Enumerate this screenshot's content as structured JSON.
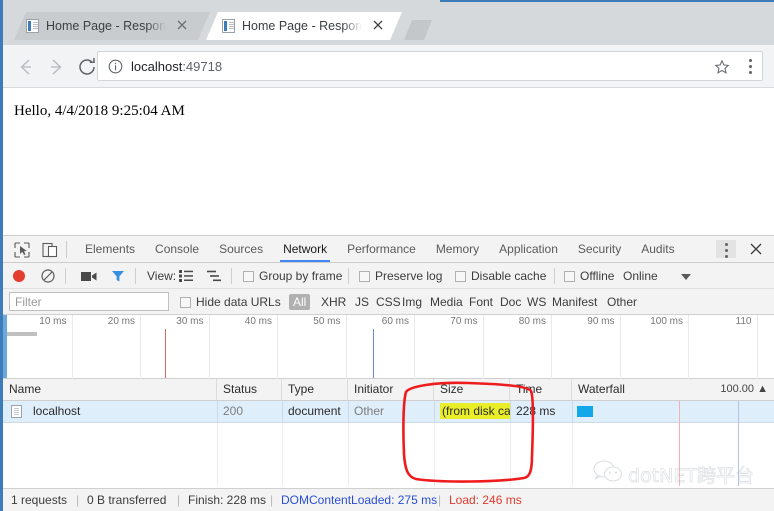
{
  "browser": {
    "tabs": [
      {
        "title": "Home Page - ResponseC",
        "active": false,
        "favicon": "page-icon"
      },
      {
        "title": "Home Page - ResponseC",
        "active": true,
        "favicon": "page-icon"
      }
    ],
    "new_tab_label": "+",
    "window_controls": {
      "minimize": "—",
      "maximize": "□",
      "close": "✕",
      "profile": "profile-avatar"
    },
    "omnibox": {
      "scheme_label": "",
      "url_host": "localhost",
      "url_port": ":49718",
      "full_url": "localhost:49718",
      "info_icon": "info-circle-icon",
      "star_icon": "star-icon",
      "menu_icon": "three-dot-menu-icon"
    },
    "nav": {
      "back": "←",
      "forward": "→",
      "reload": "⟳"
    }
  },
  "page": {
    "body_text": "Hello, 4/4/2018 9:25:04 AM"
  },
  "devtools": {
    "toolbar_icons": {
      "inspect": "inspect-element-icon",
      "device": "device-toolbar-icon",
      "kebab": "more-options-icon",
      "close": "close-devtools-icon"
    },
    "tabs": [
      {
        "label": "Elements",
        "active": false
      },
      {
        "label": "Console",
        "active": false
      },
      {
        "label": "Sources",
        "active": false
      },
      {
        "label": "Network",
        "active": true
      },
      {
        "label": "Performance",
        "active": false
      },
      {
        "label": "Memory",
        "active": false
      },
      {
        "label": "Application",
        "active": false
      },
      {
        "label": "Security",
        "active": false
      },
      {
        "label": "Audits",
        "active": false
      }
    ],
    "network_toolbar": {
      "record_icon": "record-button-icon",
      "clear_icon": "clear-icon",
      "camera_icon": "capture-screenshots-icon",
      "filter_icon": "filter-icon",
      "view_label": "View:",
      "view_list_icon": "list-view-icon",
      "view_waterfall_icon": "waterfall-view-icon",
      "group_by_frame": {
        "label": "Group by frame",
        "checked": false
      },
      "preserve_log": {
        "label": "Preserve log",
        "checked": false
      },
      "disable_cache": {
        "label": "Disable cache",
        "checked": false
      },
      "offline": {
        "label": "Offline",
        "checked": false
      },
      "online_label": "Online",
      "online_caret": "chevron-down-icon"
    },
    "filter_bar": {
      "filter_placeholder": "Filter",
      "filter_value": "",
      "hide_data_urls": {
        "label": "Hide data URLs",
        "checked": false
      },
      "types": [
        {
          "label": "All",
          "selected": true
        },
        {
          "label": "XHR",
          "selected": false
        },
        {
          "label": "JS",
          "selected": false
        },
        {
          "label": "CSS",
          "selected": false
        },
        {
          "label": "Img",
          "selected": false
        },
        {
          "label": "Media",
          "selected": false
        },
        {
          "label": "Font",
          "selected": false
        },
        {
          "label": "Doc",
          "selected": false
        },
        {
          "label": "WS",
          "selected": false
        },
        {
          "label": "Manifest",
          "selected": false
        },
        {
          "label": "Other",
          "selected": false
        }
      ]
    },
    "overview": {
      "tick_labels": [
        "10 ms",
        "20 ms",
        "30 ms",
        "40 ms",
        "50 ms",
        "60 ms",
        "70 ms",
        "80 ms",
        "90 ms",
        "100 ms",
        "110"
      ],
      "dom_content_loaded_color": "#6f86d6",
      "load_color": "#e06666"
    },
    "table": {
      "columns": [
        "Name",
        "Status",
        "Type",
        "Initiator",
        "Size",
        "Time",
        "Waterfall"
      ],
      "waterfall_scale": "100.00",
      "sort_indicator": "▲",
      "rows": [
        {
          "name": "localhost",
          "status": "200",
          "type": "document",
          "initiator": "Other",
          "size": "(from disk cache)",
          "size_highlighted": true,
          "time": "228 ms",
          "selected": true
        }
      ]
    },
    "status_bar": {
      "requests": "1 requests",
      "transferred": "0 B transferred",
      "finish": "Finish: 228 ms",
      "dom_content_loaded": "DOMContentLoaded: 275 ms",
      "load": "Load: 246 ms",
      "separator": "|"
    }
  },
  "watermark": {
    "text": "dotNET跨平台",
    "logo": "wechat-logo-icon"
  },
  "annotation": {
    "shape": "red-hand-drawn-rectangle",
    "color": "#ee1c1c",
    "target": "Size column (from disk cache)"
  }
}
